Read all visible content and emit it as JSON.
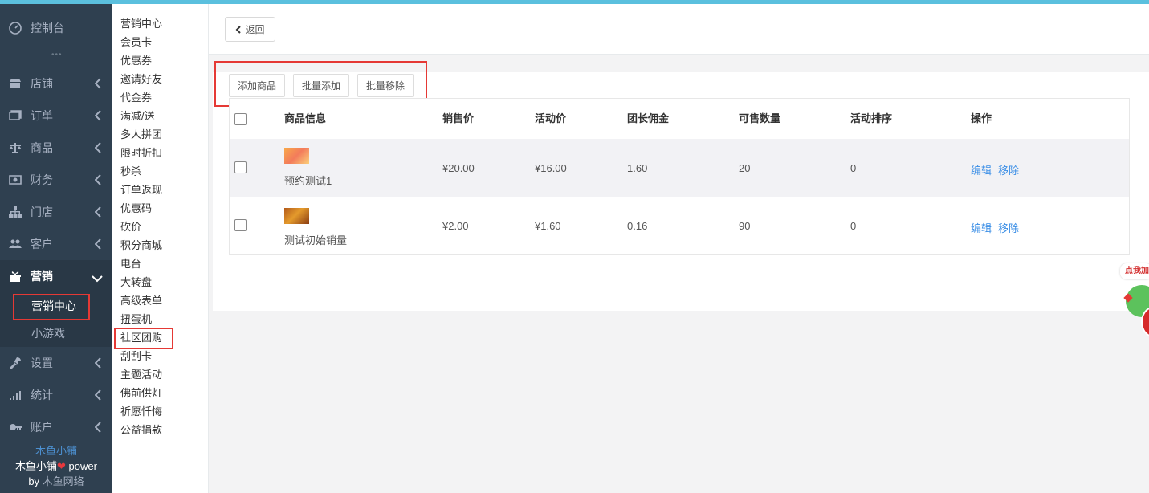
{
  "sidebar": {
    "items": [
      {
        "label": "控制台",
        "icon": "dashboard-icon"
      },
      {
        "label": "店铺",
        "icon": "shop-icon"
      },
      {
        "label": "订单",
        "icon": "order-icon"
      },
      {
        "label": "商品",
        "icon": "scale-icon"
      },
      {
        "label": "财务",
        "icon": "money-icon"
      },
      {
        "label": "门店",
        "icon": "sitemap-icon"
      },
      {
        "label": "客户",
        "icon": "users-icon"
      },
      {
        "label": "营销",
        "icon": "gift-icon"
      },
      {
        "label": "设置",
        "icon": "wrench-icon"
      },
      {
        "label": "统计",
        "icon": "signal-icon"
      },
      {
        "label": "账户",
        "icon": "key-icon"
      }
    ],
    "dots": "•••",
    "sub": [
      "营销中心",
      "小游戏"
    ],
    "footer": {
      "brand": "木鱼小铺",
      "power_prefix": "木鱼小铺",
      "heart": "❤",
      "power_suffix": " power",
      "by_prefix": "by ",
      "by_company": "木鱼网络"
    }
  },
  "submenu": [
    "营销中心",
    "会员卡",
    "优惠券",
    "邀请好友",
    "代金券",
    "满减/送",
    "多人拼团",
    "限时折扣",
    "秒杀",
    "订单返现",
    "优惠码",
    "砍价",
    "积分商城",
    "电台",
    "大转盘",
    "高级表单",
    "扭蛋机",
    "社区团购",
    "刮刮卡",
    "主题活动",
    "佛前供灯",
    "祈愿忏悔",
    "公益捐款"
  ],
  "header": {
    "back_label": "返回"
  },
  "toolbar": {
    "add": "添加商品",
    "batch_add": "批量添加",
    "batch_remove": "批量移除"
  },
  "table": {
    "columns": [
      "商品信息",
      "销售价",
      "活动价",
      "团长佣金",
      "可售数量",
      "活动排序",
      "操作"
    ],
    "rows": [
      {
        "name": "预约测试1",
        "price": "¥20.00",
        "activity_price": "¥16.00",
        "commission": "1.60",
        "stock": "20",
        "sort": "0",
        "edit": "编辑",
        "remove": "移除"
      },
      {
        "name": "测试初始销量",
        "price": "¥2.00",
        "activity_price": "¥1.60",
        "commission": "0.16",
        "stock": "90",
        "sort": "0",
        "edit": "编辑",
        "remove": "移除"
      }
    ]
  },
  "promo": {
    "text": "点我加"
  },
  "colors": {
    "accent_top": "#5bc0de",
    "sidebar_bg": "#2f4050",
    "link": "#3a8ee6",
    "highlight": "#e53935"
  }
}
